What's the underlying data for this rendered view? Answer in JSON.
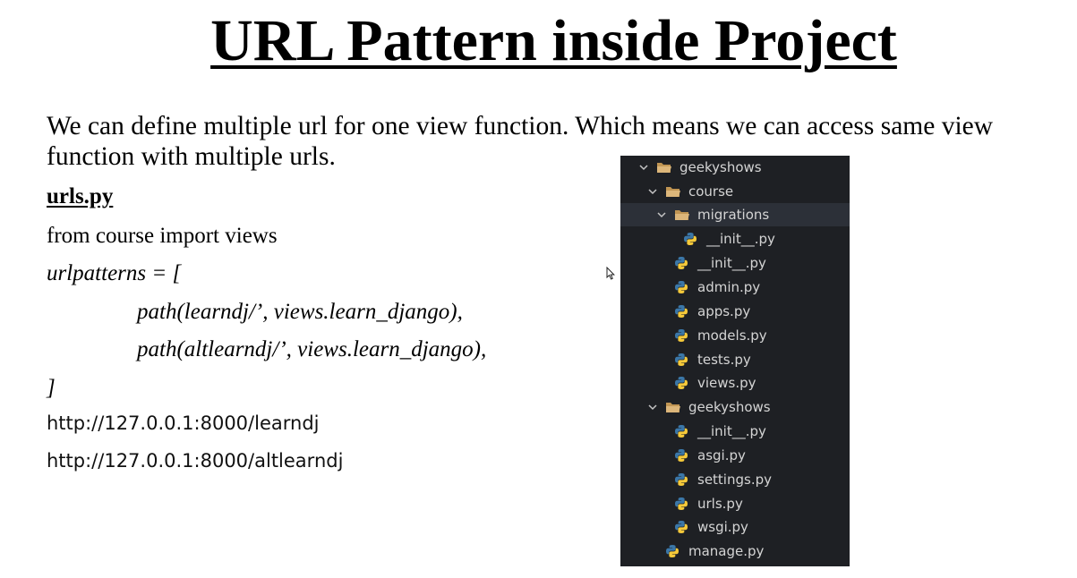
{
  "slide": {
    "title": "URL Pattern inside Project",
    "intro": "We can define multiple url for one view function. Which means we can access same view function with multiple urls.",
    "code_heading": "urls.py",
    "code_lines": [
      "from course import views",
      "urlpatterns = [",
      "path(learndj/’, views.learn_django),",
      "path(altlearndj/’, views.learn_django),",
      "]"
    ],
    "urls": [
      "http://127.0.0.1:8000/learndj",
      "http://127.0.0.1:8000/altlearndj"
    ]
  },
  "explorer": {
    "background": "#1e2024",
    "tree": [
      {
        "label": "geekyshows",
        "type": "folder",
        "expanded": true
      },
      {
        "label": "course",
        "type": "folder",
        "expanded": true
      },
      {
        "label": "migrations",
        "type": "folder",
        "expanded": true,
        "selected": true
      },
      {
        "label": "__init__.py",
        "type": "python-file"
      },
      {
        "label": "__init__.py",
        "type": "python-file"
      },
      {
        "label": "admin.py",
        "type": "python-file"
      },
      {
        "label": "apps.py",
        "type": "python-file"
      },
      {
        "label": "models.py",
        "type": "python-file"
      },
      {
        "label": "tests.py",
        "type": "python-file"
      },
      {
        "label": "views.py",
        "type": "python-file"
      },
      {
        "label": "geekyshows",
        "type": "folder",
        "expanded": true
      },
      {
        "label": "__init__.py",
        "type": "python-file"
      },
      {
        "label": "asgi.py",
        "type": "python-file"
      },
      {
        "label": "settings.py",
        "type": "python-file"
      },
      {
        "label": "urls.py",
        "type": "python-file"
      },
      {
        "label": "wsgi.py",
        "type": "python-file"
      },
      {
        "label": "manage.py",
        "type": "python-file"
      }
    ]
  },
  "icons": {
    "chevron": "chevron-down-icon",
    "folder": "folder-open-icon",
    "python": "python-file-icon",
    "cursor": "mouse-pointer-icon"
  },
  "colors": {
    "folder": "#c09553",
    "python_blue": "#3b77a8",
    "python_yellow": "#f5c93a",
    "tree_text": "#d4d4d4"
  }
}
